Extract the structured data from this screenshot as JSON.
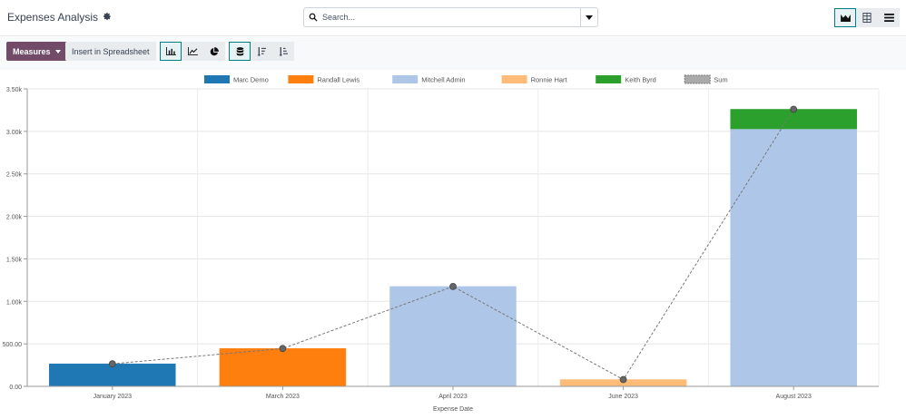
{
  "header": {
    "title": "Expenses Analysis",
    "settings_icon": "gear-icon",
    "search_placeholder": "Search...",
    "view_switcher": [
      "area-chart-icon",
      "spreadsheet-icon",
      "list-icon"
    ]
  },
  "toolbar": {
    "measures_label": "Measures",
    "insert_label": "Insert in Spreadsheet",
    "chart_type_icons": [
      "bar-chart-icon",
      "line-chart-icon",
      "pie-chart-icon"
    ],
    "option_icons": [
      "stacked-icon",
      "sort-descending-icon",
      "sort-ascending-icon"
    ]
  },
  "colors": {
    "accent": "#714b67",
    "teal": "#017e84"
  },
  "chart_data": {
    "type": "bar",
    "stacked": true,
    "xlabel": "Expense Date",
    "ylabel": "",
    "ylim": [
      0,
      3500
    ],
    "yticks": [
      "0.00",
      "500.00",
      "1.00k",
      "1.50k",
      "2.00k",
      "2.50k",
      "3.00k",
      "3.50k"
    ],
    "categories": [
      "January 2023",
      "March 2023",
      "April 2023",
      "June 2023",
      "August 2023"
    ],
    "series": [
      {
        "name": "Marc Demo",
        "color": "#1f77b4",
        "values": [
          265,
          0,
          0,
          0,
          0
        ]
      },
      {
        "name": "Randall Lewis",
        "color": "#ff7f0e",
        "values": [
          0,
          445,
          0,
          0,
          0
        ]
      },
      {
        "name": "Mitchell Admin",
        "color": "#aec7e8",
        "values": [
          0,
          0,
          1175,
          0,
          3030
        ]
      },
      {
        "name": "Ronnie Hart",
        "color": "#ffbb78",
        "values": [
          0,
          0,
          0,
          80,
          0
        ]
      },
      {
        "name": "Keith Byrd",
        "color": "#2ca02c",
        "values": [
          0,
          0,
          0,
          0,
          230
        ]
      }
    ],
    "sum": {
      "name": "Sum",
      "values": [
        265,
        445,
        1175,
        80,
        3260
      ]
    },
    "grid": true,
    "legend_position": "top"
  }
}
